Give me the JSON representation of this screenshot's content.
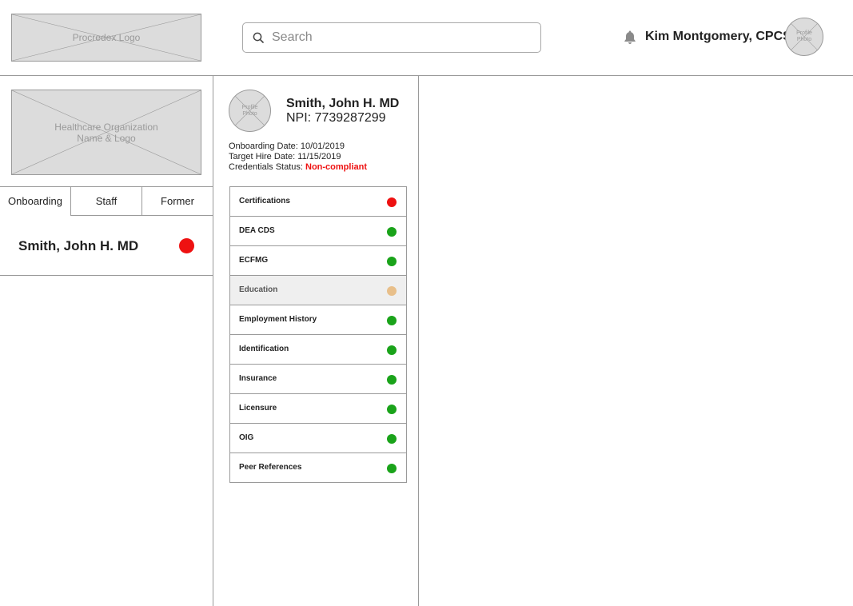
{
  "header": {
    "logo_text": "Procredex Logo",
    "search_placeholder": "Search",
    "user_name": "Kim Montgomery, CPCS",
    "user_avatar_text": "Profile Photo"
  },
  "left": {
    "org_logo_text": "Healthcare Organization Name & Logo",
    "tabs": [
      {
        "label": "Onboarding",
        "active": true
      },
      {
        "label": "Staff",
        "active": false
      },
      {
        "label": "Former",
        "active": false
      }
    ],
    "staff": [
      {
        "name": "Smith, John H. MD",
        "status_color": "#ee1111"
      }
    ]
  },
  "provider": {
    "avatar_text": "Profile Photo",
    "name": "Smith, John H. MD",
    "npi": "NPI: 7739287299",
    "onboarding_date": "Onboarding Date: 10/01/2019",
    "target_hire_date": "Target Hire Date: 11/15/2019",
    "credentials_label": "Credentials Status: ",
    "credentials_status": "Non-compliant",
    "credentials_status_color": "#ee1111"
  },
  "checklist": [
    {
      "label": "Certifications",
      "color": "#ee1111",
      "selected": false
    },
    {
      "label": "DEA CDS",
      "color": "#1aa31a",
      "selected": false
    },
    {
      "label": "ECFMG",
      "color": "#1aa31a",
      "selected": false
    },
    {
      "label": "Education",
      "color": "#e8bf8a",
      "selected": true
    },
    {
      "label": "Employment History",
      "color": "#1aa31a",
      "selected": false
    },
    {
      "label": "Identification",
      "color": "#1aa31a",
      "selected": false
    },
    {
      "label": "Insurance",
      "color": "#1aa31a",
      "selected": false
    },
    {
      "label": "Licensure",
      "color": "#1aa31a",
      "selected": false
    },
    {
      "label": "OIG",
      "color": "#1aa31a",
      "selected": false
    },
    {
      "label": "Peer References",
      "color": "#1aa31a",
      "selected": false
    }
  ]
}
